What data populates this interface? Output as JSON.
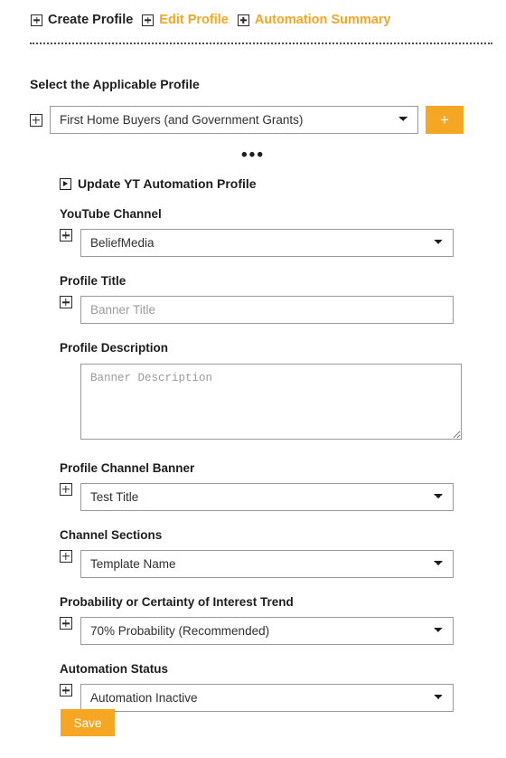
{
  "nav": {
    "items": [
      {
        "label": "Create Profile",
        "state": "active",
        "icon": "plus-box-icon"
      },
      {
        "label": "Edit Profile",
        "state": "link",
        "icon": "plus-box-icon"
      },
      {
        "label": "Automation Summary",
        "state": "link",
        "icon": "plus-box-icon"
      }
    ]
  },
  "colors": {
    "accent": "#f5a623",
    "text": "#1d1d1d",
    "border": "#9a9a9a",
    "placeholder": "#9b9b9b"
  },
  "profile_section": {
    "heading": "Select the Applicable Profile",
    "expand_icon": "plus-box-icon",
    "select_value": "First Home Buyers (and Government Grants)",
    "add_button_label": "+"
  },
  "divider": {
    "ellipsis": "•••"
  },
  "panel": {
    "title": "Update YT Automation Profile",
    "title_icon": "play-box-icon",
    "fields": [
      {
        "label": "YouTube Channel",
        "type": "select",
        "value": "BeliefMedia",
        "icon": "plus-box-icon"
      },
      {
        "label": "Profile Title",
        "type": "input",
        "value": "",
        "placeholder": "Banner Title",
        "icon": "plus-box-icon"
      },
      {
        "label": "Profile Description",
        "type": "textarea",
        "value": "",
        "placeholder": "Banner Description"
      },
      {
        "label": "Profile Channel Banner",
        "type": "select",
        "value": "Test Title",
        "icon": "plus-box-icon"
      },
      {
        "label": "Channel Sections",
        "type": "select",
        "value": "Template Name",
        "icon": "plus-box-icon"
      },
      {
        "label": "Probability or Certainty of Interest Trend",
        "type": "select",
        "value": "70% Probability (Recommended)",
        "icon": "plus-box-icon"
      },
      {
        "label": "Automation Status",
        "type": "select",
        "value": "Automation Inactive",
        "icon": "plus-box-icon"
      }
    ]
  },
  "save": {
    "label": "Save"
  }
}
